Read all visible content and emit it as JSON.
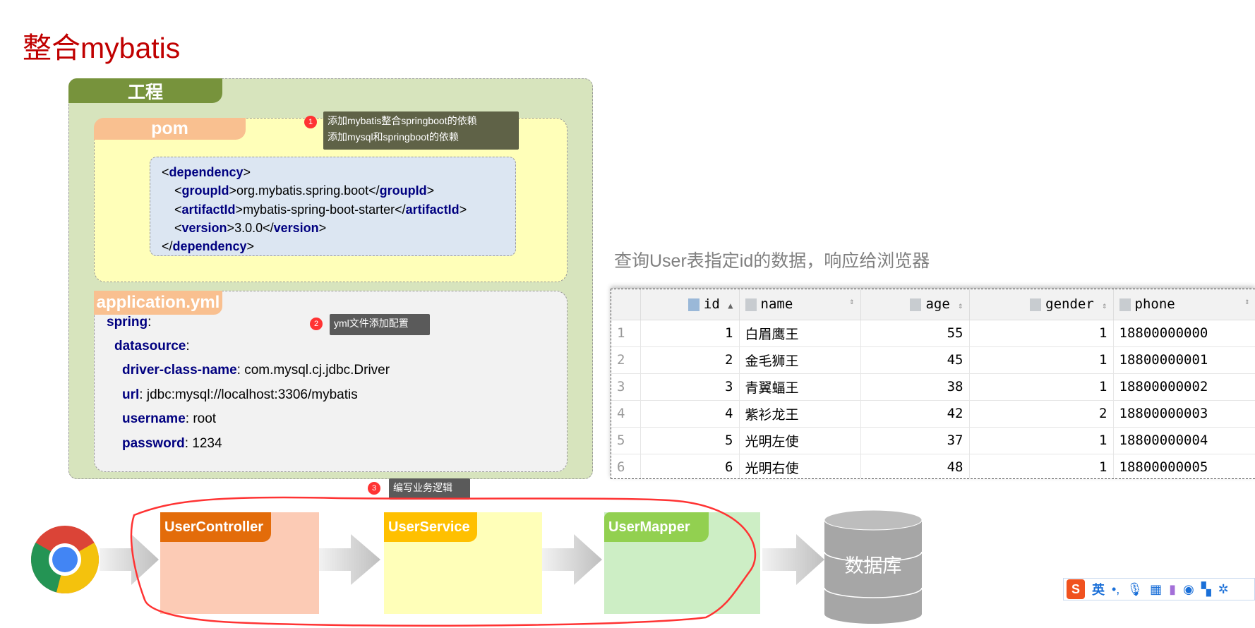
{
  "title": "整合mybatis",
  "project": {
    "label": "工程"
  },
  "pom": {
    "label": "pom",
    "code": {
      "l1a": "<",
      "l1t": "dependency",
      "l1b": ">",
      "l2t1": "groupId",
      "l2v": "org.mybatis.spring.boot",
      "l3t1": "artifactId",
      "l3v": "mybatis-spring-boot-starter",
      "l4t1": "version",
      "l4v": "3.0.0",
      "l5t": "dependency"
    }
  },
  "tips": [
    {
      "num": "1",
      "lines": [
        "添加mybatis整合springboot的依赖",
        "添加mysql和springboot的依赖"
      ]
    },
    {
      "num": "2",
      "lines": [
        "yml文件添加配置"
      ]
    },
    {
      "num": "3",
      "lines": [
        "编写业务逻辑"
      ]
    }
  ],
  "yml": {
    "label": "application.yml",
    "lines": [
      {
        "key": "spring",
        "val": ""
      },
      {
        "key": "datasource",
        "val": ""
      },
      {
        "key": "driver-class-name",
        "val": " com.mysql.cj.jdbc.Driver"
      },
      {
        "key": "url",
        "val": " jdbc:mysql://localhost:3306/mybatis"
      },
      {
        "key": "username",
        "val": " root"
      },
      {
        "key": "password",
        "val": " 1234"
      }
    ]
  },
  "heading": "查询User表指定id的数据，响应给浏览器",
  "table": {
    "columns": [
      "id",
      "name",
      "age",
      "gender",
      "phone"
    ],
    "rows": [
      {
        "n": "1",
        "id": "1",
        "name": "白眉鹰王",
        "age": "55",
        "gender": "1",
        "phone": "18800000000"
      },
      {
        "n": "2",
        "id": "2",
        "name": "金毛狮王",
        "age": "45",
        "gender": "1",
        "phone": "18800000001"
      },
      {
        "n": "3",
        "id": "3",
        "name": "青翼蝠王",
        "age": "38",
        "gender": "1",
        "phone": "18800000002"
      },
      {
        "n": "4",
        "id": "4",
        "name": "紫衫龙王",
        "age": "42",
        "gender": "2",
        "phone": "18800000003"
      },
      {
        "n": "5",
        "id": "5",
        "name": "光明左使",
        "age": "37",
        "gender": "1",
        "phone": "18800000004"
      },
      {
        "n": "6",
        "id": "6",
        "name": "光明右使",
        "age": "48",
        "gender": "1",
        "phone": "18800000005"
      }
    ]
  },
  "flow": {
    "controller": "UserController",
    "service": "UserService",
    "mapper": "UserMapper",
    "db": "数据库",
    "colors": {
      "controller": "#e36c0a",
      "service": "#ffc000",
      "mapper": "#92d050",
      "highlight": "#ff3333"
    }
  },
  "ime": {
    "lang": "英",
    "punct": "•,"
  }
}
